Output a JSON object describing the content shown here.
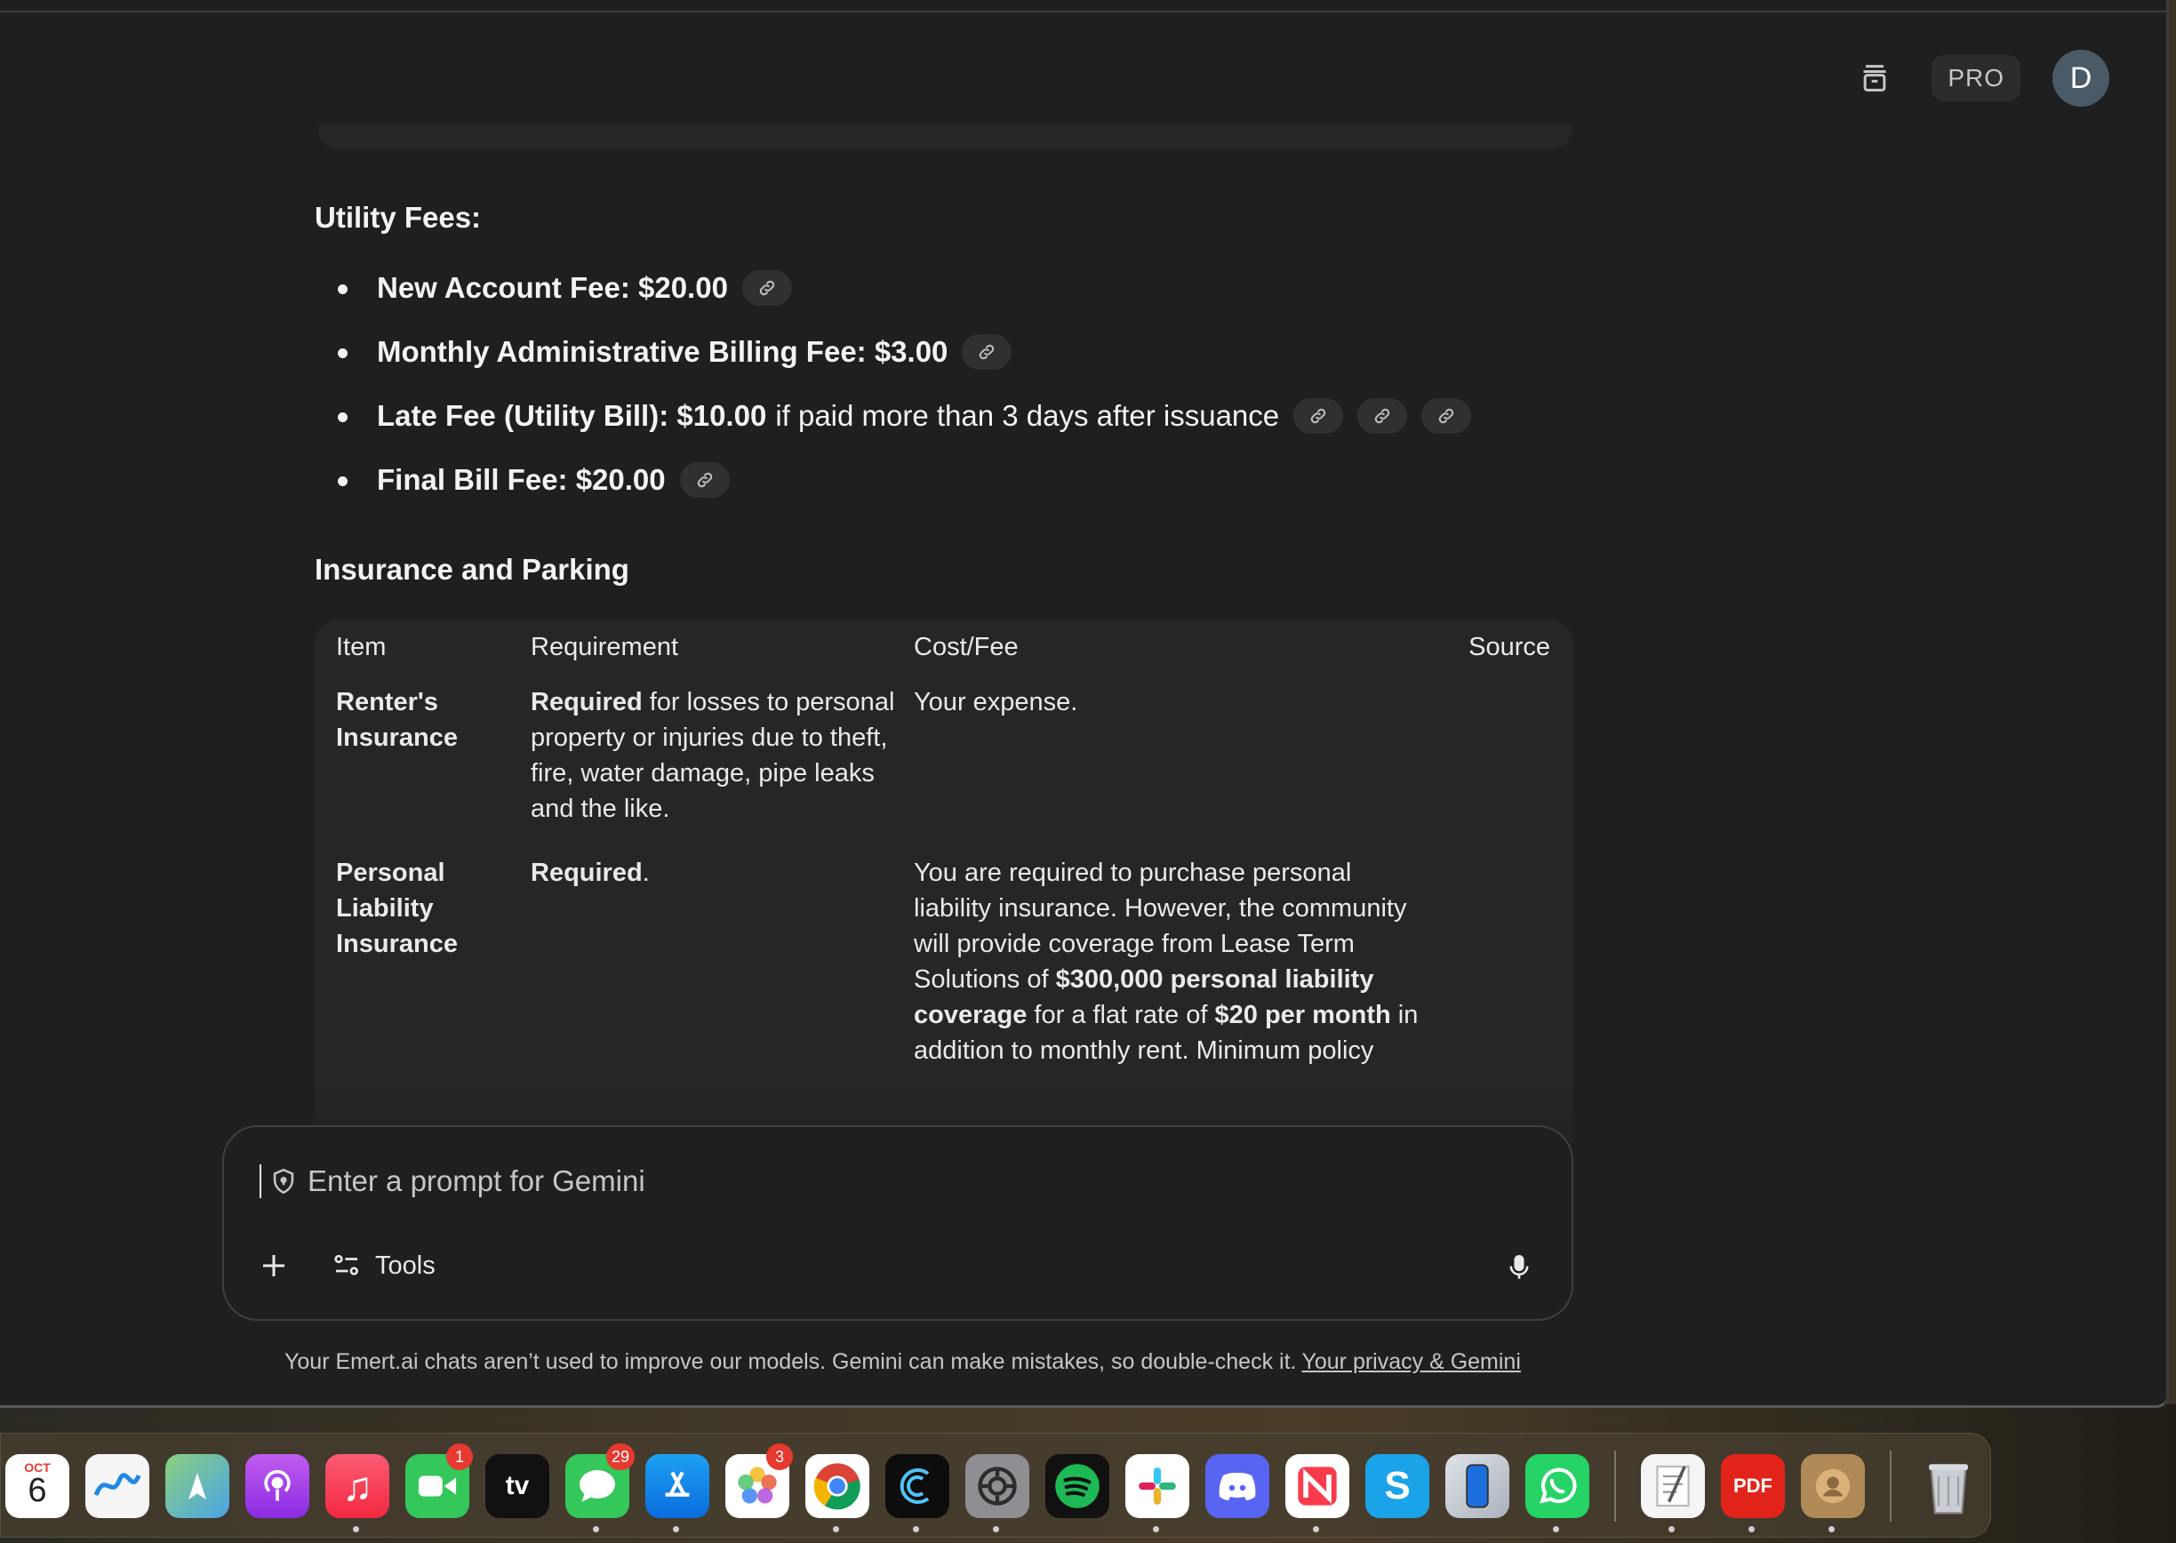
{
  "header": {
    "pro_label": "PRO",
    "avatar_initial": "D"
  },
  "utility": {
    "heading": "Utility Fees:",
    "items": [
      {
        "label": "New Account Fee: $20.00",
        "extra": "",
        "links": 1
      },
      {
        "label": "Monthly Administrative Billing Fee: $3.00",
        "extra": "",
        "links": 1
      },
      {
        "label": "Late Fee (Utility Bill): $10.00",
        "extra": "if paid more than 3 days after issuance",
        "links": 3
      },
      {
        "label": "Final Bill Fee: $20.00",
        "extra": "",
        "links": 1
      }
    ]
  },
  "insurance": {
    "heading": "Insurance and Parking",
    "columns": [
      "Item",
      "Requirement",
      "Cost/Fee",
      "Source"
    ],
    "rows": [
      {
        "item": "Renter's Insurance",
        "req_bold": "Required",
        "req_rest": " for losses to personal property or injuries due to theft, fire, water damage, pipe leaks and the like.",
        "cost_parts": [
          {
            "t": "Your expense.",
            "b": false
          }
        ],
        "source": ""
      },
      {
        "item": "Personal Liability Insurance",
        "req_bold": "Required",
        "req_rest": ".",
        "cost_parts": [
          {
            "t": "You are required to purchase personal liability insurance. However, the community will provide coverage from Lease Term Solutions of ",
            "b": false
          },
          {
            "t": "$300,000 personal liability coverage",
            "b": true
          },
          {
            "t": " for a flat rate of ",
            "b": false
          },
          {
            "t": "$20 per month",
            "b": true
          },
          {
            "t": " in addition to monthly rent. Minimum policy",
            "b": false
          }
        ],
        "source": ""
      }
    ]
  },
  "prompt": {
    "placeholder": "Enter a prompt for Gemini",
    "tools_label": "Tools"
  },
  "footer": {
    "disclaimer": "Your Emert.ai chats aren’t used to improve our models. Gemini can make mistakes, so double-check it.",
    "privacy_link": "Your privacy & Gemini"
  },
  "dock": {
    "calendar_month": "OCT",
    "calendar_day": "6",
    "facetime_badge": "1",
    "messages_badge": "29",
    "photos_badge": "3",
    "tv_label": "tv",
    "pdf_label": "PDF",
    "skype_label": "S"
  }
}
